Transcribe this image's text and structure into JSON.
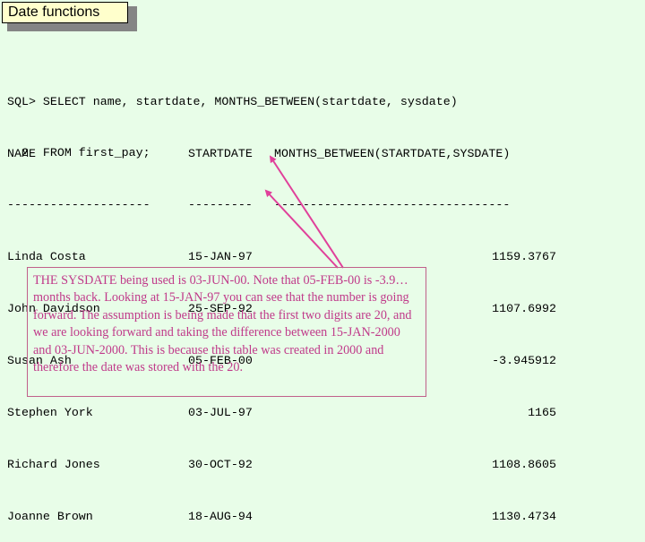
{
  "slide": {
    "title": "Date functions"
  },
  "sql": {
    "lines": [
      "SQL> SELECT name, startdate, MONTHS_BETWEEN(startdate, sysdate)",
      "  2  FROM first_pay;"
    ]
  },
  "result": {
    "headers": [
      "NAME",
      "STARTDATE",
      "MONTHS_BETWEEN(STARTDATE,SYSDATE)"
    ],
    "separators": [
      "--------------------",
      "---------",
      "---------------------------------"
    ],
    "rows": [
      {
        "name": "Linda Costa",
        "startdate": "15-JAN-97",
        "months_between": "1159.3767"
      },
      {
        "name": "John Davidson",
        "startdate": "25-SEP-92",
        "months_between": "1107.6992"
      },
      {
        "name": "Susan Ash",
        "startdate": "05-FEB-00",
        "months_between": "-3.945912"
      },
      {
        "name": "Stephen York",
        "startdate": "03-JUL-97",
        "months_between": "1165"
      },
      {
        "name": "Richard Jones",
        "startdate": "30-OCT-92",
        "months_between": "1108.8605"
      },
      {
        "name": "Joanne Brown",
        "startdate": "18-AUG-94",
        "months_between": "1130.4734"
      }
    ]
  },
  "note": {
    "text": "THE SYSDATE being used is 03-JUN-00.  Note that 05-FEB-00 is -3.9… months back.  Looking at 15-JAN-97 you can see that the number is going forward.  The assumption is being made that the first two digits are 20, and we are looking forward and taking the difference between 15-JAN-2000 and 03-JUN-2000. This is because this table was created in 2000 and therefore the date was stored with the 20.",
    "arrow_targets": [
      "15-JAN-97",
      "05-FEB-00"
    ]
  },
  "colors": {
    "background": "#e8fde8",
    "title_fill": "#ffffcc",
    "annotation": "#c03a8a",
    "arrow": "#e0409a"
  }
}
